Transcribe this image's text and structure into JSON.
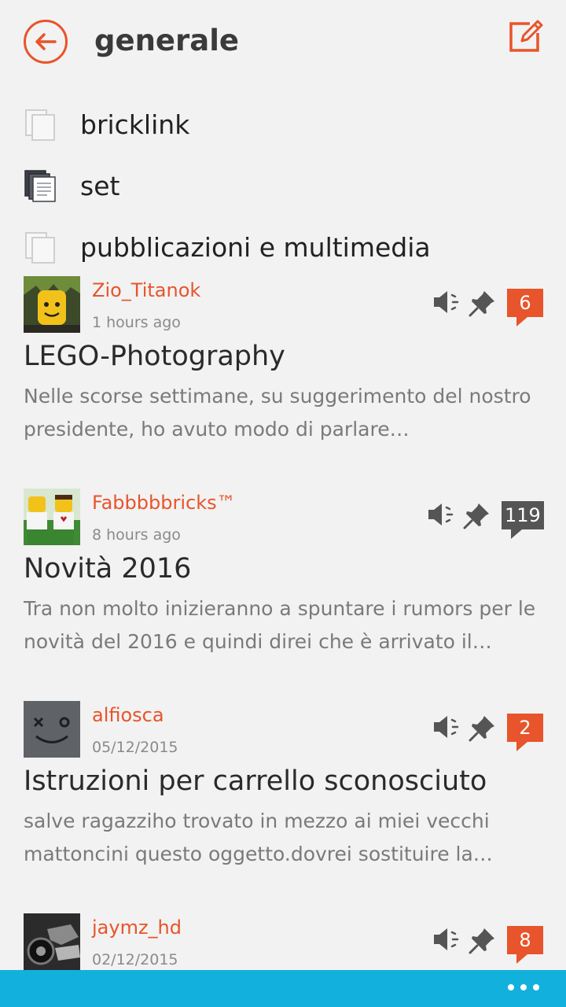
{
  "header": {
    "title": "generale",
    "back_icon": "arrow-left-icon",
    "compose_icon": "compose-icon",
    "accent": "#e8542b"
  },
  "subforums": [
    {
      "label": "bricklink",
      "icon": "subforum-empty-icon"
    },
    {
      "label": "set",
      "icon": "subforum-unread-icon"
    },
    {
      "label": "pubblicazioni e multimedia",
      "icon": "subforum-empty-icon"
    }
  ],
  "topics": [
    {
      "author": "Zio_Titanok",
      "time": "1 hours ago",
      "title": "LEGO-Photography",
      "preview": "Nelle scorse settimane, su suggerimento del nostro presidente, ho avuto modo di parlare…",
      "count": "6",
      "badge_color": "#e8542b"
    },
    {
      "author": "Fabbbbbricks™",
      "time": "8 hours ago",
      "title": "Novità 2016",
      "preview": "Tra non molto inizieranno a spuntare i rumors per le novità del 2016 e quindi direi che è arrivato il…",
      "count": "119",
      "badge_color": "#555555"
    },
    {
      "author": "alfiosca",
      "time": "05/12/2015",
      "title": "Istruzioni per carrello sconosciuto",
      "preview": "salve ragazziho trovato in mezzo ai miei vecchi mattoncini questo oggetto.dovrei sostituire la…",
      "count": "2",
      "badge_color": "#e8542b"
    },
    {
      "author": "jaymz_hd",
      "time": "02/12/2015",
      "title": "",
      "preview": "",
      "count": "8",
      "badge_color": "#e8542b"
    }
  ],
  "app_bar": {
    "color": "#12b0dd",
    "more_icon": "more-dots-icon"
  }
}
